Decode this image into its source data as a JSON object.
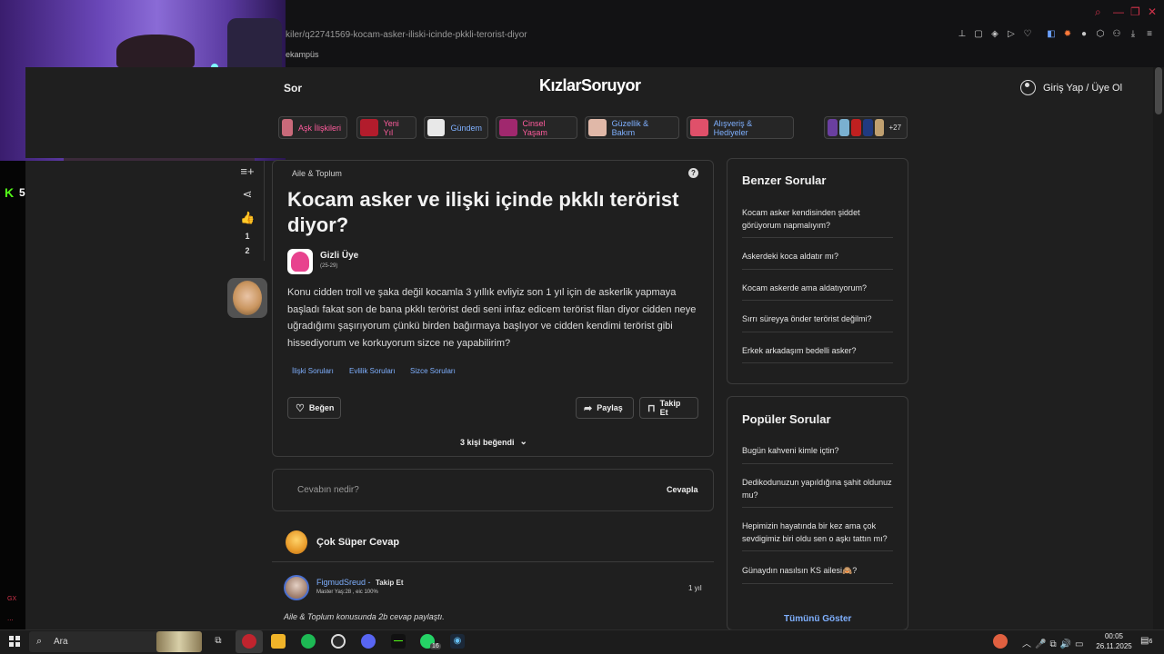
{
  "browser": {
    "url": "kiler/q22741569-kocam-asker-iliski-icinde-pkkli-terorist-diyor",
    "bookmark": "ekampüs"
  },
  "stream": {
    "kick_count": "5",
    "gx_label": "GX",
    "gx_dots": "..."
  },
  "site": {
    "ask_label": "Sor",
    "logo": "KızlarSoruyor",
    "login_label": "Giriş Yap / Üye Ol",
    "more_count": "+27",
    "categories": [
      {
        "label": "Aşk İlişkileri",
        "color": "#ff5c9d"
      },
      {
        "label": "Yeni Yıl",
        "color": "#ff5c9d"
      },
      {
        "label": "Gündem",
        "color": "#7fb0ff"
      },
      {
        "label": "Cinsel Yaşam",
        "color": "#ff5c9d"
      },
      {
        "label": "Güzellik & Bakım",
        "color": "#7fb0ff"
      },
      {
        "label": "Alışveriş & Hediyeler",
        "color": "#7fb0ff"
      }
    ]
  },
  "rail": {
    "like_count": "1",
    "dislike_count": "2"
  },
  "question": {
    "category": "Aile & Toplum",
    "help": "?",
    "title": "Kocam asker ve ilişki içinde pkklı terörist diyor?",
    "user": "Gizli Üye",
    "age": "(25-29)",
    "body": "Konu cidden troll ve şaka değil kocamla 3 yıllık evliyiz son 1 yıl için de askerlik yapmaya başladı fakat son de bana pkklı terörist dedi seni infaz edicem terörist filan diyor cidden neye uğradığımı şaşırıyorum çünkü birden bağırmaya başlıyor ve cidden kendimi terörist gibi hissediyorum ve korkuyorum sizce ne yapabilirim?",
    "tags": [
      "İlişki Soruları",
      "Evlilik Soruları",
      "Sizce Soruları"
    ],
    "like_btn": "Beğen",
    "share_btn": "Paylaş",
    "follow_btn": "Takip Et",
    "likes_summary": "3 kişi beğendi"
  },
  "answer_box": {
    "placeholder": "Cevabın nedir?",
    "submit": "Cevapla"
  },
  "best_answer": {
    "title": "Çok Süper Cevap",
    "user": "FigmudSreud",
    "dash": "-",
    "follow": "Takip Et",
    "meta": "Master Yaş:28 , eic 100%",
    "time": "1 yıl",
    "note": "Aile & Toplum konusunda 2b cevap paylaştı."
  },
  "similar": {
    "title": "Benzer Sorular",
    "items": [
      "Kocam asker kendisinden şiddet görüyorum napmalıyım?",
      "Askerdeki koca aldatır mı?",
      "Kocam askerde ama aldatıyorum?",
      "Sırrı süreyya önder terörist değilmi?",
      "Erkek arkadaşım bedelli asker?"
    ]
  },
  "popular": {
    "title": "Popüler Sorular",
    "items": [
      "Bugün kahveni kimle içtin?",
      "Dedikodunuzun yapıldığına şahit oldunuz mu?",
      "Hepimizin hayatında bir kez ama çok sevdigimiz biri oldu sen o aşkı tattın mı?",
      "Günaydın nasılsın KS ailesi🙈?"
    ],
    "show_all": "Tümünü Göster"
  },
  "taskbar": {
    "search_placeholder": "Ara",
    "whatsapp_badge": "16",
    "time": "00:05",
    "date": "26.11.2025",
    "notif_count": "6"
  }
}
